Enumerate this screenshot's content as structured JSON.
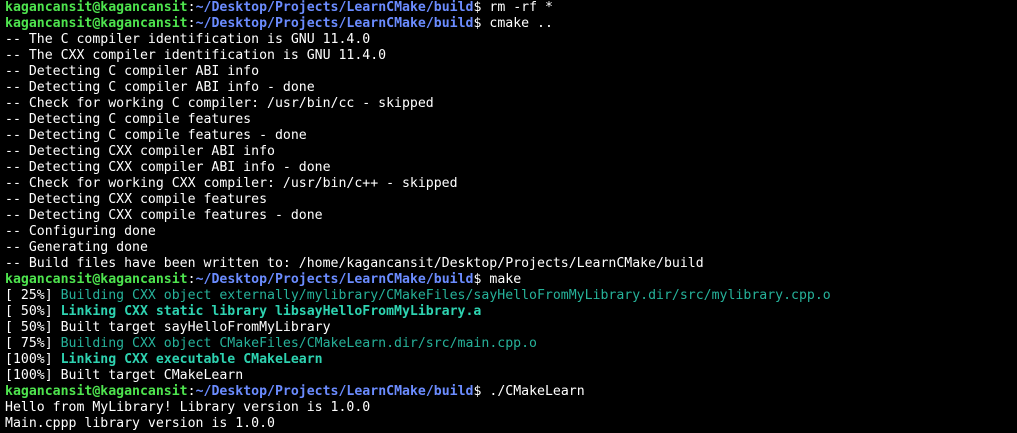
{
  "prompt": {
    "user_host": "kagancansit@kagancansit",
    "path": "~/Desktop/Projects/LearnCMake/build",
    "symbol": "$"
  },
  "lines": [
    {
      "type": "prompt",
      "command": "rm -rf *"
    },
    {
      "type": "prompt",
      "command": "cmake .."
    },
    {
      "type": "out",
      "text": "-- The C compiler identification is GNU 11.4.0"
    },
    {
      "type": "out",
      "text": "-- The CXX compiler identification is GNU 11.4.0"
    },
    {
      "type": "out",
      "text": "-- Detecting C compiler ABI info"
    },
    {
      "type": "out",
      "text": "-- Detecting C compiler ABI info - done"
    },
    {
      "type": "out",
      "text": "-- Check for working C compiler: /usr/bin/cc - skipped"
    },
    {
      "type": "out",
      "text": "-- Detecting C compile features"
    },
    {
      "type": "out",
      "text": "-- Detecting C compile features - done"
    },
    {
      "type": "out",
      "text": "-- Detecting CXX compiler ABI info"
    },
    {
      "type": "out",
      "text": "-- Detecting CXX compiler ABI info - done"
    },
    {
      "type": "out",
      "text": "-- Check for working CXX compiler: /usr/bin/c++ - skipped"
    },
    {
      "type": "out",
      "text": "-- Detecting CXX compile features"
    },
    {
      "type": "out",
      "text": "-- Detecting CXX compile features - done"
    },
    {
      "type": "out",
      "text": "-- Configuring done"
    },
    {
      "type": "out",
      "text": "-- Generating done"
    },
    {
      "type": "out",
      "text": "-- Build files have been written to: /home/kagancansit/Desktop/Projects/LearnCMake/build"
    },
    {
      "type": "prompt",
      "command": "make"
    },
    {
      "type": "build",
      "pct": "[ 25%] ",
      "style": "green",
      "text": "Building CXX object externally/mylibrary/CMakeFiles/sayHelloFromMyLibrary.dir/src/mylibrary.cpp.o"
    },
    {
      "type": "build",
      "pct": "[ 50%] ",
      "style": "green-bold",
      "text": "Linking CXX static library libsayHelloFromMyLibrary.a"
    },
    {
      "type": "build",
      "pct": "[ 50%] ",
      "style": "white",
      "text": "Built target sayHelloFromMyLibrary"
    },
    {
      "type": "build",
      "pct": "[ 75%] ",
      "style": "green",
      "text": "Building CXX object CMakeFiles/CMakeLearn.dir/src/main.cpp.o"
    },
    {
      "type": "build",
      "pct": "[100%] ",
      "style": "green-bold",
      "text": "Linking CXX executable CMakeLearn"
    },
    {
      "type": "build",
      "pct": "[100%] ",
      "style": "white",
      "text": "Built target CMakeLearn"
    },
    {
      "type": "prompt",
      "command": "./CMakeLearn"
    },
    {
      "type": "out",
      "text": "Hello from MyLibrary! Library version is 1.0.0"
    },
    {
      "type": "out",
      "text": "Main.cppp library version is 1.0.0"
    }
  ],
  "colors": {
    "background": "#000000",
    "user_host": "#4ee44e",
    "path": "#6b8cff",
    "build_green": "#26b29a",
    "build_green_bold": "#2ed3b1",
    "text": "#ffffff"
  }
}
